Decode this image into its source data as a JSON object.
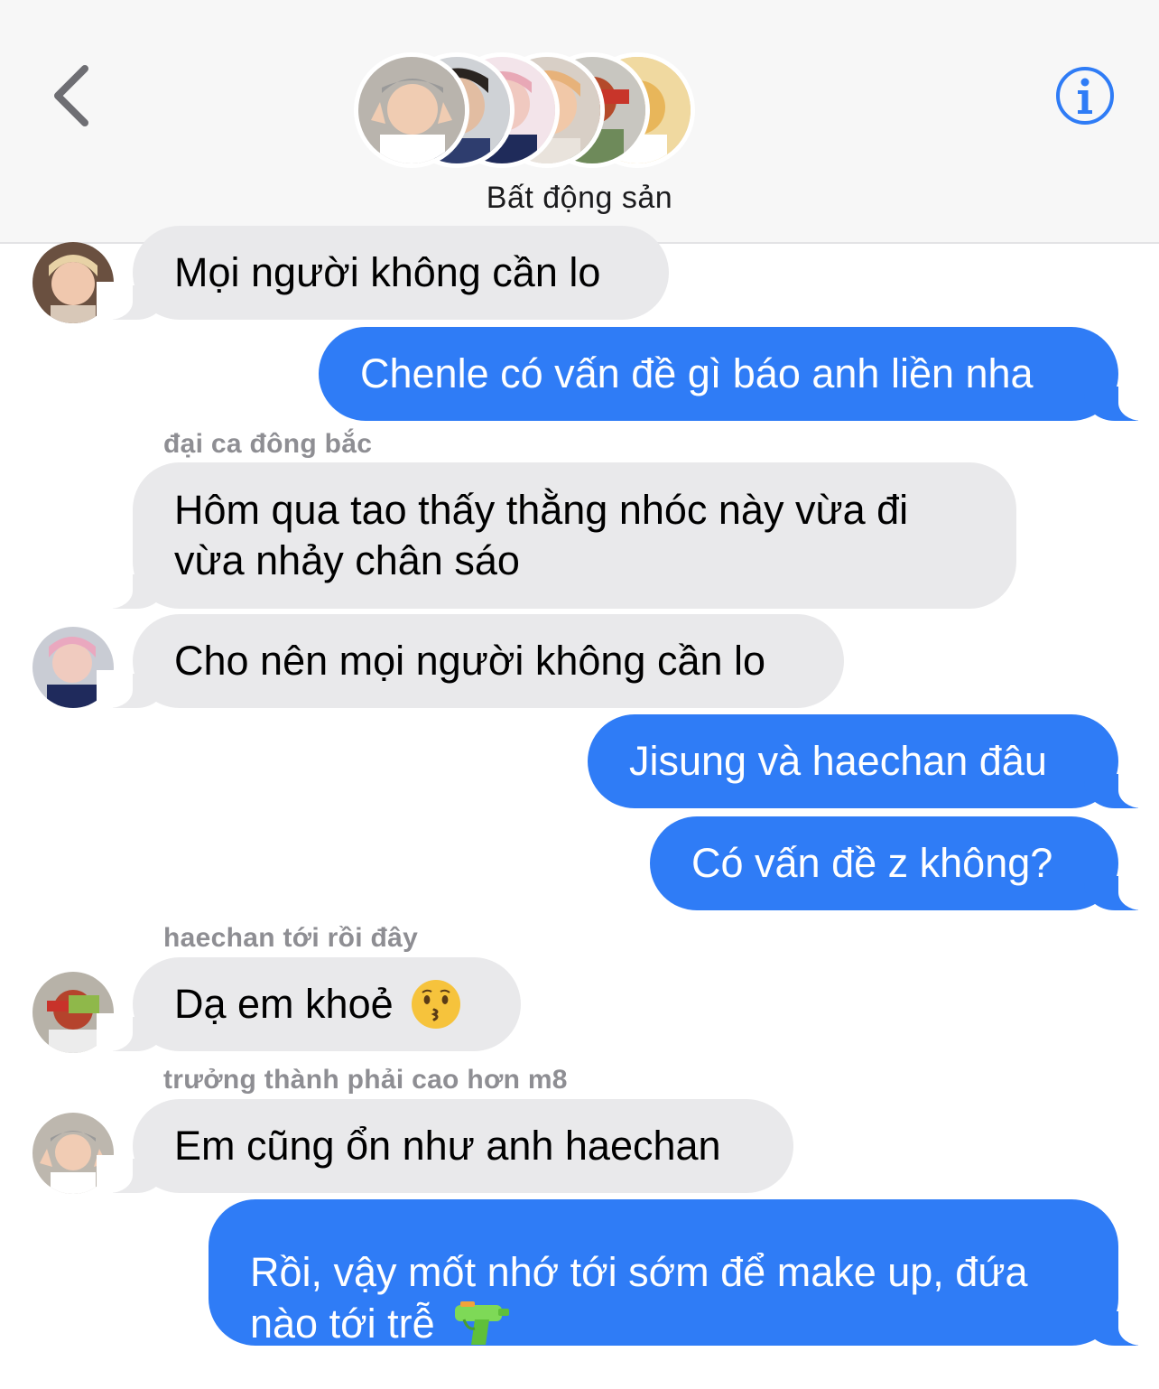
{
  "header": {
    "back_icon": "chevron-left-icon",
    "info_icon": "info-circle-icon",
    "group_name": "Bất động sản",
    "accent": "#2f7cf6"
  },
  "messages": [
    {
      "dir": "in",
      "text": "Mọi người không cần lo"
    },
    {
      "dir": "out",
      "text": "Chenle có vấn đề gì báo anh liền nha"
    },
    {
      "dir": "in",
      "sender": "đại ca đông bắc",
      "text": "Hôm qua tao thấy thằng nhóc này vừa đi\nvừa nhảy chân sáo"
    },
    {
      "dir": "in",
      "text": "Cho nên mọi người không cần lo"
    },
    {
      "dir": "out",
      "text": "Jisung và haechan đâu"
    },
    {
      "dir": "out",
      "text": "Có vấn đề z không?"
    },
    {
      "dir": "in",
      "sender": "haechan tới rồi đây",
      "text": "Dạ em khoẻ",
      "emoji": "kissing-face-icon"
    },
    {
      "dir": "in",
      "sender": "trưởng thành phải cao hơn m8",
      "text": "Em cũng ổn như anh haechan"
    },
    {
      "dir": "out",
      "text": "Rồi, vậy mốt nhớ tới sớm để make up, đứa\nnào tới trễ",
      "emoji": "water-pistol-icon"
    }
  ],
  "colors": {
    "incoming_bubble": "#e9e9eb",
    "outgoing_bubble": "#2f7cf6",
    "sender_label": "#8e8e93"
  }
}
